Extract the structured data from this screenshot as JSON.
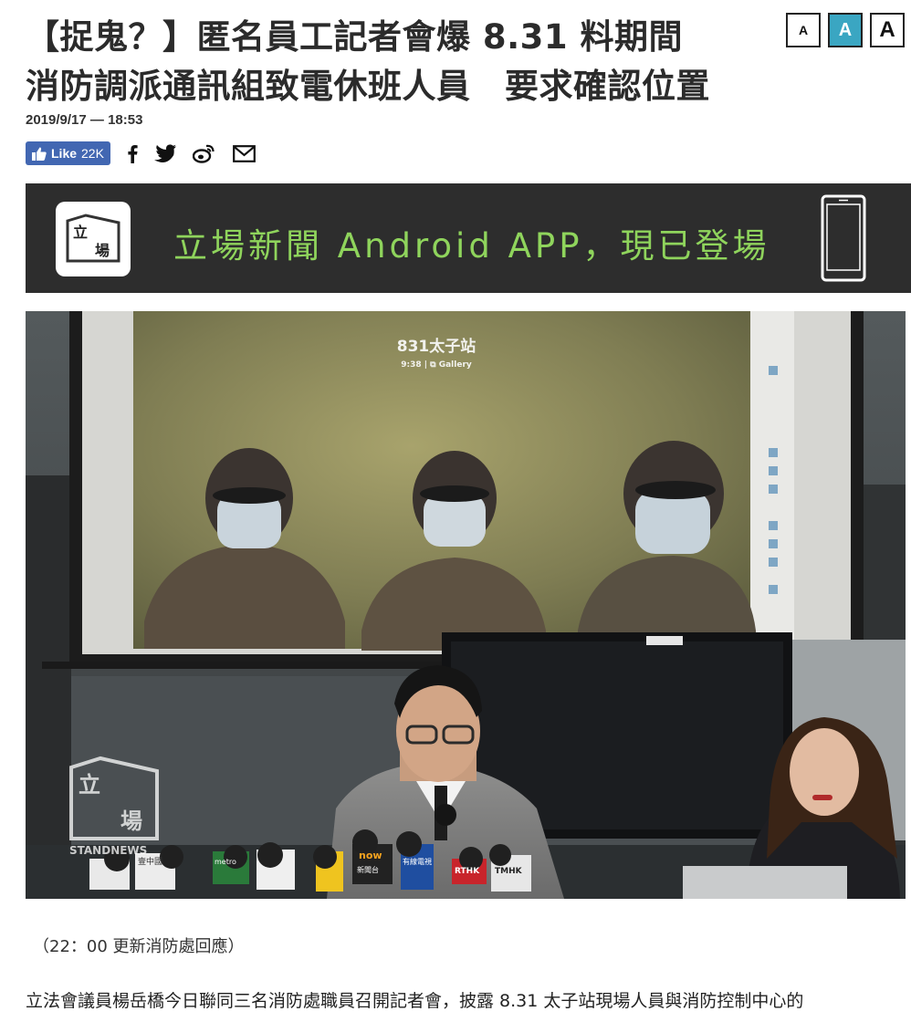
{
  "article": {
    "title_line1": "【捉鬼？】匿名員工記者會爆 8.31 料期間",
    "title_line2": "消防調派通訊組致電休班人員　要求確認位置",
    "date": "2019/9/17 — 18:53",
    "caption_note": "（22：00 更新消防處回應）",
    "body_line1": "立法會議員楊岳橋今日聯同三名消防處職員召開記者會，披露 8.31 太子站現場人員與消防控制中心的"
  },
  "font_size_controls": {
    "small": "A",
    "medium": "A",
    "large": "A"
  },
  "share": {
    "like_label": "Like",
    "like_count": "22K",
    "icons": [
      "facebook-icon",
      "twitter-icon",
      "weibo-icon",
      "email-icon"
    ]
  },
  "banner": {
    "logo_char_top": "立",
    "logo_char_bottom": "場",
    "text": "立場新聞 Android APP，現已登場",
    "text_color": "#8fd45c",
    "bg_color": "#2d2d2d"
  },
  "photo": {
    "screen_title": "831太子站",
    "screen_subtitle": "9:38 | ⧉ Gallery",
    "watermark_top": "立",
    "watermark_bottom": "場",
    "watermark_brand": "STANDNEWS",
    "mic_labels": [
      "now",
      "新聞台",
      "有線電視",
      "RTHK",
      "TMHK",
      "metro",
      "壹中國"
    ]
  },
  "colors": {
    "accent": "#3aa6c2",
    "facebook": "#4267b2"
  }
}
